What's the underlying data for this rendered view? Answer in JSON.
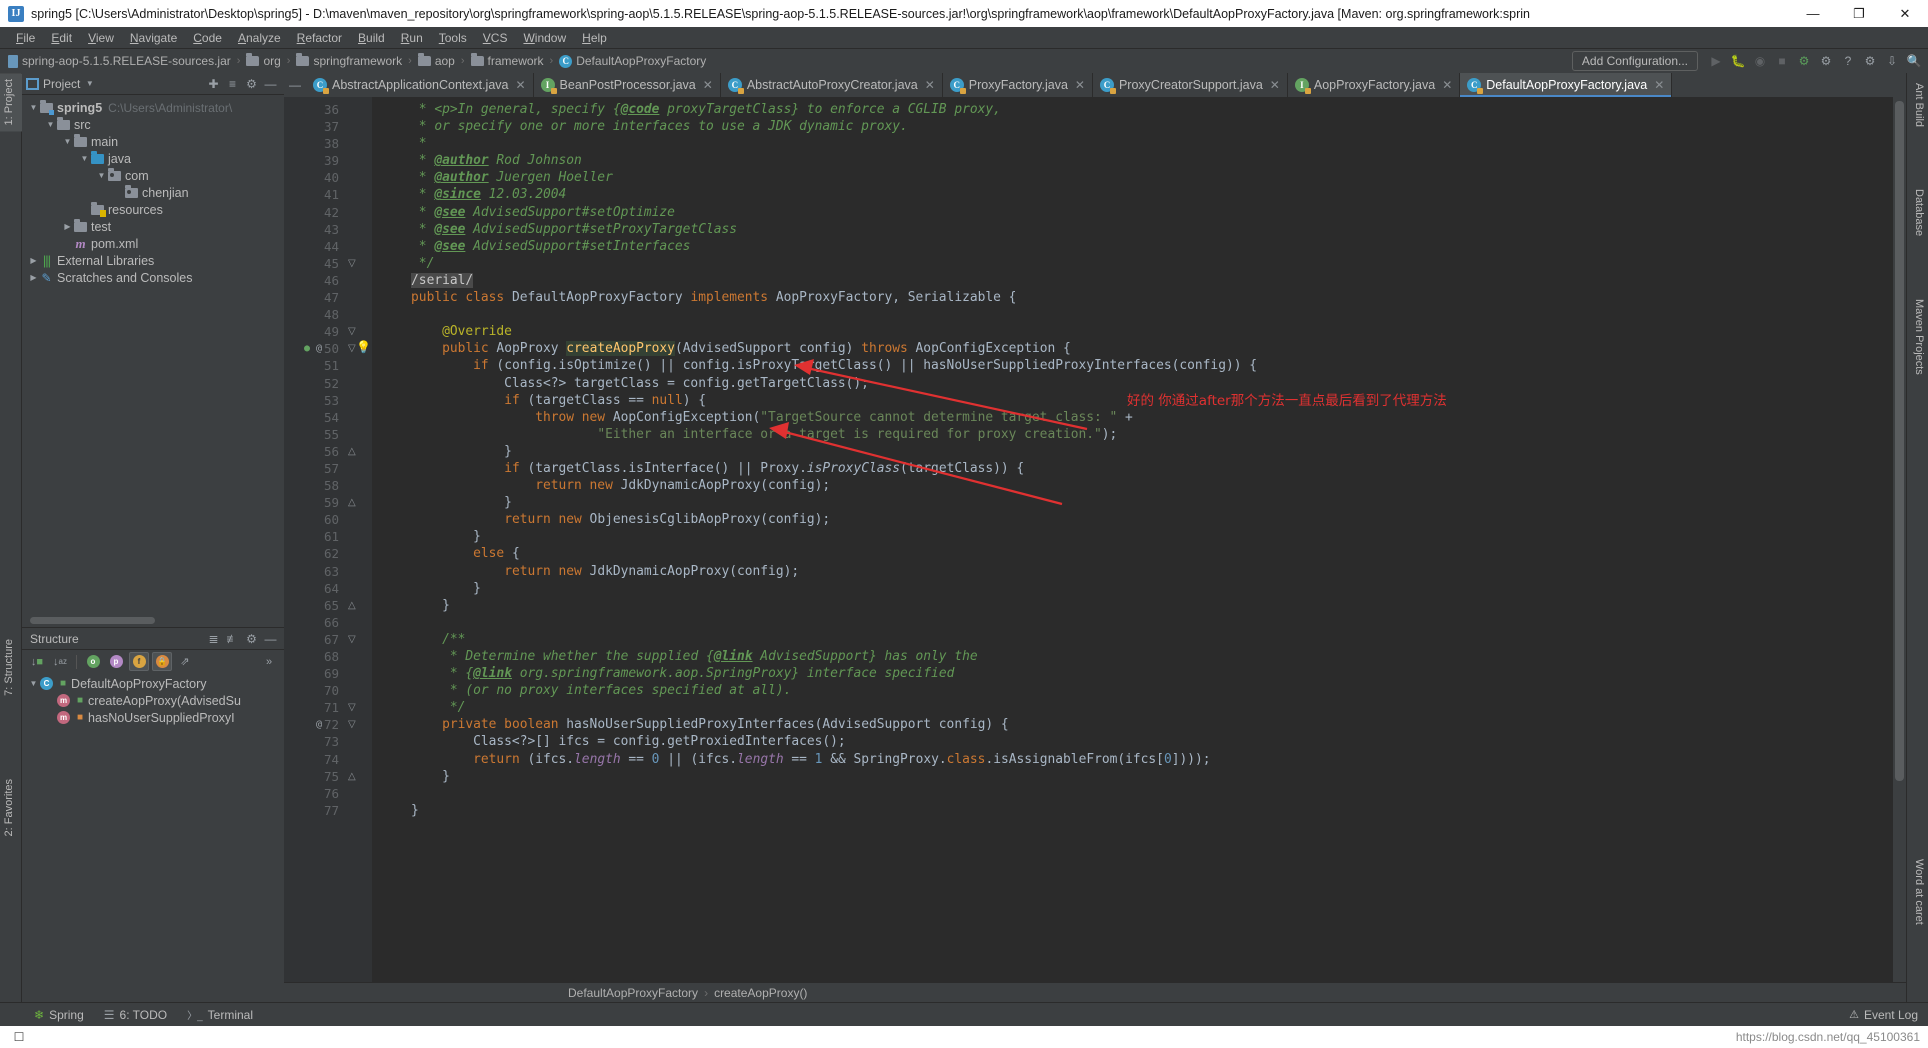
{
  "window": {
    "title": "spring5 [C:\\Users\\Administrator\\Desktop\\spring5] - D:\\maven\\maven_repository\\org\\springframework\\spring-aop\\5.1.5.RELEASE\\spring-aop-5.1.5.RELEASE-sources.jar!\\org\\springframework\\aop\\framework\\DefaultAopProxyFactory.java [Maven: org.springframework:sprin",
    "logo": "IJ",
    "minimize": "—",
    "maximize": "❐",
    "close": "✕"
  },
  "menu": [
    "File",
    "Edit",
    "View",
    "Navigate",
    "Code",
    "Analyze",
    "Refactor",
    "Build",
    "Run",
    "Tools",
    "VCS",
    "Window",
    "Help"
  ],
  "breadcrumb": [
    {
      "icon": "jar-icon",
      "label": "spring-aop-5.1.5.RELEASE-sources.jar"
    },
    {
      "icon": "folder-icon",
      "label": "org"
    },
    {
      "icon": "folder-icon",
      "label": "springframework"
    },
    {
      "icon": "folder-icon",
      "label": "aop"
    },
    {
      "icon": "folder-icon",
      "label": "framework"
    },
    {
      "icon": "class-icon",
      "label": "DefaultAopProxyFactory"
    }
  ],
  "toolbar": {
    "add_configuration": "Add Configuration...",
    "icons": [
      "run-icon",
      "debug-icon",
      "run-with-coverage-icon",
      "stop-icon",
      "build-icon",
      "search-everywhere-icon",
      "help-icon",
      "settings-icon",
      "update-icon",
      "search-icon"
    ]
  },
  "left_strips": {
    "top": "1: Project",
    "structure": "7: Structure",
    "favorites": "2: Favorites"
  },
  "right_strips": {
    "ant": "Ant Build",
    "database": "Database",
    "maven": "Maven Projects",
    "word": "Word at caret"
  },
  "project_panel": {
    "title": "Project",
    "header_icons": [
      "locate-icon",
      "collapse-all-icon",
      "gear-icon",
      "hide-icon"
    ],
    "tree": [
      {
        "depth": 0,
        "toggle": "▼",
        "icon": "module-folder-icon",
        "label": "spring5",
        "bold": true,
        "dim": "C:\\Users\\Administrator\\"
      },
      {
        "depth": 1,
        "toggle": "▼",
        "icon": "source-folder-icon",
        "label": "src",
        "bold": false,
        "dim": ""
      },
      {
        "depth": 2,
        "toggle": "▼",
        "icon": "folder-icon",
        "label": "main",
        "bold": false,
        "dim": ""
      },
      {
        "depth": 3,
        "toggle": "▼",
        "icon": "source-root-icon",
        "label": "java",
        "bold": false,
        "dim": ""
      },
      {
        "depth": 4,
        "toggle": "▼",
        "icon": "package-icon",
        "label": "com",
        "bold": false,
        "dim": ""
      },
      {
        "depth": 5,
        "toggle": "",
        "icon": "package-icon",
        "label": "chenjian",
        "bold": false,
        "dim": ""
      },
      {
        "depth": 3,
        "toggle": "",
        "icon": "resources-folder-icon",
        "label": "resources",
        "bold": false,
        "dim": ""
      },
      {
        "depth": 2,
        "toggle": "▶",
        "icon": "folder-icon",
        "label": "test",
        "bold": false,
        "dim": ""
      },
      {
        "depth": 2,
        "toggle": "",
        "icon": "maven-icon",
        "label": "pom.xml",
        "bold": false,
        "dim": ""
      },
      {
        "depth": 0,
        "toggle": "▶",
        "icon": "libraries-icon",
        "label": "External Libraries",
        "bold": false,
        "dim": ""
      },
      {
        "depth": 0,
        "toggle": "▶",
        "icon": "scratches-icon",
        "label": "Scratches and Consoles",
        "bold": false,
        "dim": ""
      }
    ]
  },
  "structure_panel": {
    "title": "Structure",
    "header_icons": [
      "expand-all-icon",
      "collapse-all-icon",
      "gear-icon",
      "hide-icon"
    ],
    "toolbar_icons": [
      "sort-by-visibility-icon",
      "sort-alphabetically-icon",
      "show-anonymous-icon",
      "show-properties-icon",
      "show-fields-icon",
      "show-non-public-icon",
      "show-inherited-icon",
      "more-icon"
    ],
    "more": "»",
    "tree": [
      {
        "depth": 0,
        "toggle": "▼",
        "icon": "class-icon",
        "label": "DefaultAopProxyFactory"
      },
      {
        "depth": 1,
        "toggle": "",
        "icon": "method-icon",
        "label": "createAopProxy(AdvisedSu"
      },
      {
        "depth": 1,
        "toggle": "",
        "icon": "method-icon",
        "label": "hasNoUserSuppliedProxyI"
      }
    ]
  },
  "editor_tabs": [
    {
      "label": "AbstractApplicationContext.java",
      "kind": "class",
      "active": false
    },
    {
      "label": "BeanPostProcessor.java",
      "kind": "interface",
      "active": false
    },
    {
      "label": "AbstractAutoProxyCreator.java",
      "kind": "class",
      "active": false
    },
    {
      "label": "ProxyFactory.java",
      "kind": "class",
      "active": false
    },
    {
      "label": "ProxyCreatorSupport.java",
      "kind": "class",
      "active": false
    },
    {
      "label": "AopProxyFactory.java",
      "kind": "interface",
      "active": false
    },
    {
      "label": "DefaultAopProxyFactory.java",
      "kind": "class",
      "active": true
    }
  ],
  "editor": {
    "first_line": 36,
    "last_line": 77,
    "lines": [
      {
        "n": 36,
        "html": "     * &lt;p&gt;In general, specify {<u class=\"tag\">@code</u> proxyTargetClass} to enforce a CGLIB proxy,",
        "cls": "cmt"
      },
      {
        "n": 37,
        "html": "     * or specify one or more interfaces to use a JDK dynamic proxy.",
        "cls": "cmt"
      },
      {
        "n": 38,
        "html": "     *",
        "cls": "cmt"
      },
      {
        "n": 39,
        "html": "     * <u class=\"tag\">@author</u> Rod Johnson",
        "cls": "cmt"
      },
      {
        "n": 40,
        "html": "     * <u class=\"tag\">@author</u> Juergen Hoeller",
        "cls": "cmt"
      },
      {
        "n": 41,
        "html": "     * <u class=\"tag\">@since</u> 12.03.2004",
        "cls": "cmt"
      },
      {
        "n": 42,
        "html": "     * <u class=\"tag\">@see</u> AdvisedSupport#setOptimize",
        "cls": "cmt"
      },
      {
        "n": 43,
        "html": "     * <u class=\"tag\">@see</u> AdvisedSupport#setProxyTargetClass",
        "cls": "cmt"
      },
      {
        "n": 44,
        "html": "     * <u class=\"tag\">@see</u> AdvisedSupport#setInterfaces",
        "cls": "cmt"
      },
      {
        "n": 45,
        "html": "     */",
        "cls": "cmt"
      },
      {
        "n": 46,
        "html": "    <span class=\"serialbox\">/serial/</span>",
        "cls": ""
      },
      {
        "n": 47,
        "html": "    <span class=\"k\">public class</span> DefaultAopProxyFactory <span class=\"k\">implements</span> AopProxyFactory, Serializable {",
        "cls": ""
      },
      {
        "n": 48,
        "html": "",
        "cls": ""
      },
      {
        "n": 49,
        "html": "        <span class=\"ann\">@Override</span>",
        "cls": ""
      },
      {
        "n": 50,
        "html": "        <span class=\"k\">public</span> AopProxy <span class=\"fn sel\">createAopProxy</span>(AdvisedSupport config) <span class=\"k\">throws</span> AopConfigException {",
        "cls": ""
      },
      {
        "n": 51,
        "html": "            <span class=\"k\">if</span> (config.isOptimize() || config.isProxyTargetClass() || hasNoUserSuppliedProxyInterfaces(config)) {",
        "cls": ""
      },
      {
        "n": 52,
        "html": "                Class&lt;?&gt; targetClass = config.getTargetClass();",
        "cls": ""
      },
      {
        "n": 53,
        "html": "                <span class=\"k\">if</span> (targetClass == <span class=\"k\">null</span>) {",
        "cls": ""
      },
      {
        "n": 54,
        "html": "                    <span class=\"k\">throw new</span> AopConfigException(<span class=\"str\">\"TargetSource cannot determine target class: \"</span> +",
        "cls": ""
      },
      {
        "n": 55,
        "html": "                            <span class=\"str\">\"Either an interface or a target is required for proxy creation.\"</span>);",
        "cls": ""
      },
      {
        "n": 56,
        "html": "                }",
        "cls": ""
      },
      {
        "n": 57,
        "html": "                <span class=\"k\">if</span> (targetClass.isInterface() || Proxy.<span class=\"ital\">isProxyClass</span>(targetClass)) {",
        "cls": ""
      },
      {
        "n": 58,
        "html": "                    <span class=\"k\">return new</span> JdkDynamicAopProxy(config);",
        "cls": ""
      },
      {
        "n": 59,
        "html": "                }",
        "cls": ""
      },
      {
        "n": 60,
        "html": "                <span class=\"k\">return new</span> ObjenesisCglibAopProxy(config);",
        "cls": ""
      },
      {
        "n": 61,
        "html": "            }",
        "cls": ""
      },
      {
        "n": 62,
        "html": "            <span class=\"k\">else</span> {",
        "cls": ""
      },
      {
        "n": 63,
        "html": "                <span class=\"k\">return new</span> JdkDynamicAopProxy(config);",
        "cls": ""
      },
      {
        "n": 64,
        "html": "            }",
        "cls": ""
      },
      {
        "n": 65,
        "html": "        }",
        "cls": ""
      },
      {
        "n": 66,
        "html": "",
        "cls": ""
      },
      {
        "n": 67,
        "html": "        <span class=\"cmt\">/**</span>",
        "cls": ""
      },
      {
        "n": 68,
        "html": "         <span class=\"cmt\">* Determine whether the supplied {</span><u class=\"tag\">@link</u><span class=\"cmt\"> AdvisedSupport} has only the</span>",
        "cls": ""
      },
      {
        "n": 69,
        "html": "         <span class=\"cmt\">* {</span><u class=\"tag\">@link</u><span class=\"cmt\"> org.springframework.aop.SpringProxy} interface specified</span>",
        "cls": ""
      },
      {
        "n": 70,
        "html": "         <span class=\"cmt\">* (or no proxy interfaces specified at all).</span>",
        "cls": ""
      },
      {
        "n": 71,
        "html": "         <span class=\"cmt\">*/</span>",
        "cls": ""
      },
      {
        "n": 72,
        "html": "        <span class=\"k\">private boolean</span> hasNoUserSuppliedProxyInterfaces(AdvisedSupport config) {",
        "cls": ""
      },
      {
        "n": 73,
        "html": "            Class&lt;?&gt;[] ifcs = config.getProxiedInterfaces();",
        "cls": ""
      },
      {
        "n": 74,
        "html": "            <span class=\"k\">return</span> (ifcs.<span class=\"fi\">length</span> == <span class=\"num\">0</span> || (ifcs.<span class=\"fi\">length</span> == <span class=\"num\">1</span> &amp;&amp; SpringProxy.<span class=\"k\">class</span>.isAssignableFrom(ifcs[<span class=\"num\">0</span>])));",
        "cls": ""
      },
      {
        "n": 75,
        "html": "        }",
        "cls": ""
      },
      {
        "n": 76,
        "html": "",
        "cls": ""
      },
      {
        "n": 77,
        "html": "    }",
        "cls": ""
      }
    ],
    "annotation": "好的  你通过after那个方法一直点最后看到了代理方法",
    "annotation_color": "#e03131"
  },
  "editor_breadcrumb": [
    "DefaultAopProxyFactory",
    "createAopProxy()"
  ],
  "status": {
    "tools": [
      {
        "icon": "spring-leaf-icon",
        "label": "Spring"
      },
      {
        "icon": "todo-icon",
        "label": "6: TODO"
      },
      {
        "icon": "terminal-icon",
        "label": "Terminal"
      }
    ],
    "event_log": "Event Log",
    "event_log_icon": "bell-icon"
  },
  "watermark": {
    "url": "https://blog.csdn.net/qq_45100361"
  },
  "colors": {
    "accent": "#4a88c7",
    "editor_bg": "#2b2b2b",
    "panel_bg": "#3c3f41",
    "gutter_bg": "#313335",
    "keyword": "#cc7832",
    "string": "#6a8759",
    "comment": "#629755",
    "number": "#6897bb",
    "method": "#ffc66d",
    "annotation_red": "#e03131"
  }
}
